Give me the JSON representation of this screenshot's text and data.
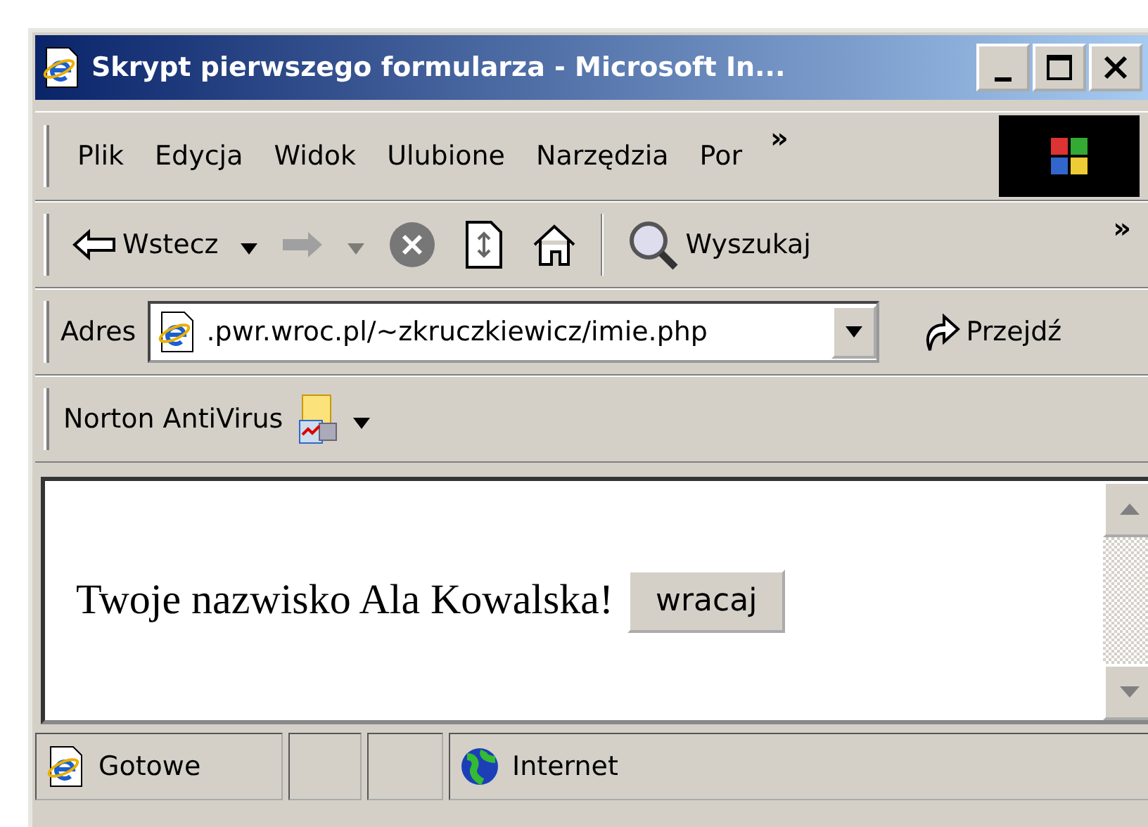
{
  "window": {
    "title": "Skrypt pierwszego formularza - Microsoft In..."
  },
  "menu": {
    "items": [
      "Plik",
      "Edycja",
      "Widok",
      "Ulubione",
      "Narzędzia",
      "Por"
    ],
    "overflow": "»"
  },
  "toolbar": {
    "items": [
      {
        "kind": "back",
        "label": "Wstecz",
        "disabled": false
      },
      {
        "kind": "forward",
        "disabled": true
      },
      {
        "kind": "stop",
        "disabled": false
      },
      {
        "kind": "refresh",
        "disabled": false
      },
      {
        "kind": "home",
        "disabled": false
      },
      {
        "kind": "search",
        "label": "Wyszukaj",
        "disabled": false
      }
    ],
    "overflow": "»"
  },
  "address": {
    "label": "Adres",
    "value": ".pwr.wroc.pl/~zkruczkiewicz/imie.php",
    "go": "Przejdź"
  },
  "links_bar": {
    "label": "Norton AntiVirus"
  },
  "content": {
    "text": "Twoje nazwisko Ala Kowalska!",
    "button": "wracaj"
  },
  "status_bar": {
    "text": "Gotowe",
    "zone": "Internet"
  }
}
